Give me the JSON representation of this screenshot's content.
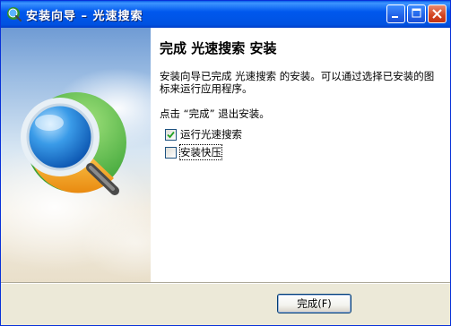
{
  "window": {
    "title": "安装向导 – 光速搜索"
  },
  "content": {
    "heading": "完成 光速搜索 安装",
    "description": "安装向导已完成 光速搜索 的安装。可以通过选择已安装的图标来运行应用程序。",
    "hint": "点击 “完成” 退出安装。",
    "checkboxes": [
      {
        "label": "运行光速搜索",
        "checked": true
      },
      {
        "label": "安装快压",
        "checked": false
      }
    ]
  },
  "footer": {
    "finish_label": "完成(F)"
  },
  "colors": {
    "titlebar": "#0058ee",
    "panel_sky": "#9cbde3",
    "icon_blue": "#1f7fd8",
    "icon_green": "#3cb83c",
    "icon_orange": "#f0a020"
  }
}
